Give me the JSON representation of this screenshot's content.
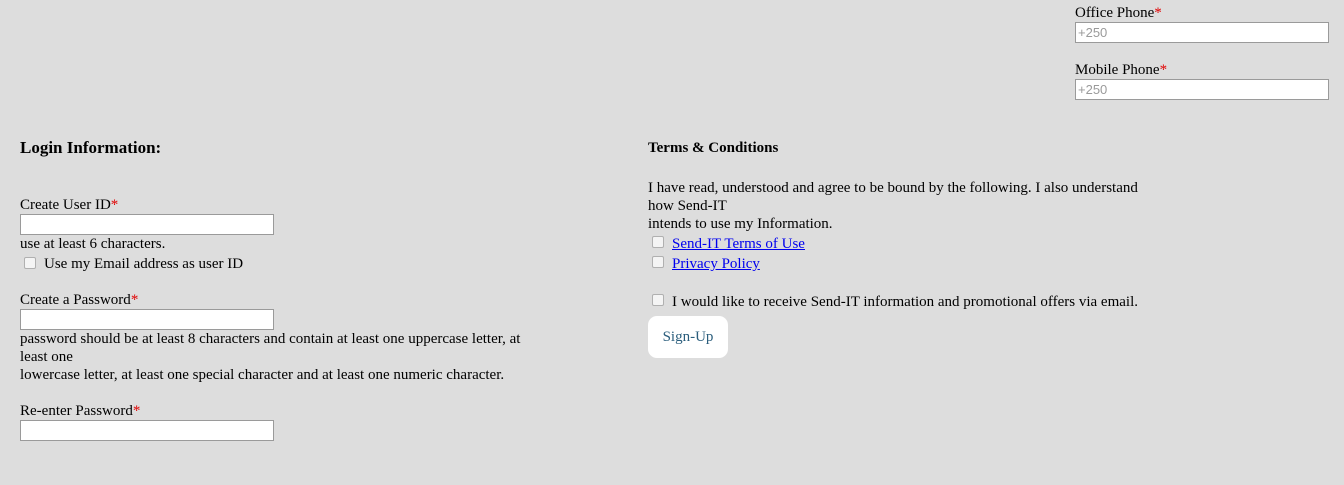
{
  "contact": {
    "office_phone": {
      "label": "Office Phone",
      "required_mark": "*",
      "placeholder": "+250"
    },
    "mobile_phone": {
      "label": "Mobile Phone",
      "required_mark": "*",
      "placeholder": "+250"
    }
  },
  "login": {
    "heading": "Login Information:",
    "user_id": {
      "label": "Create User ID",
      "required_mark": "*",
      "hint": "use at least 6 characters.",
      "use_email_label": "Use my Email address as user ID"
    },
    "password": {
      "label": "Create a Password",
      "required_mark": "*",
      "hint_line1": "password should be at least 8 characters and contain at least one uppercase letter, at",
      "hint_line2": "least one",
      "hint_line3": "lowercase letter, at least one special character and at least one numeric character."
    },
    "reenter_password": {
      "label": "Re-enter Password",
      "required_mark": "*"
    }
  },
  "terms": {
    "heading": "Terms & Conditions",
    "intro_line1": "I have read, understood and agree to be bound by the following. I also understand",
    "intro_line2": "how Send-IT",
    "intro_line3": "intends to use my Information.",
    "terms_of_use_link": "Send-IT Terms of Use",
    "privacy_policy_link": "Privacy Policy",
    "promo_label": "I would like to receive Send-IT information and promotional offers via email.",
    "signup_button": "Sign-Up"
  },
  "colors": {
    "background": "#dddddd",
    "required": "#e00000",
    "link": "#0000ee",
    "button_text": "#2a5d7c"
  }
}
